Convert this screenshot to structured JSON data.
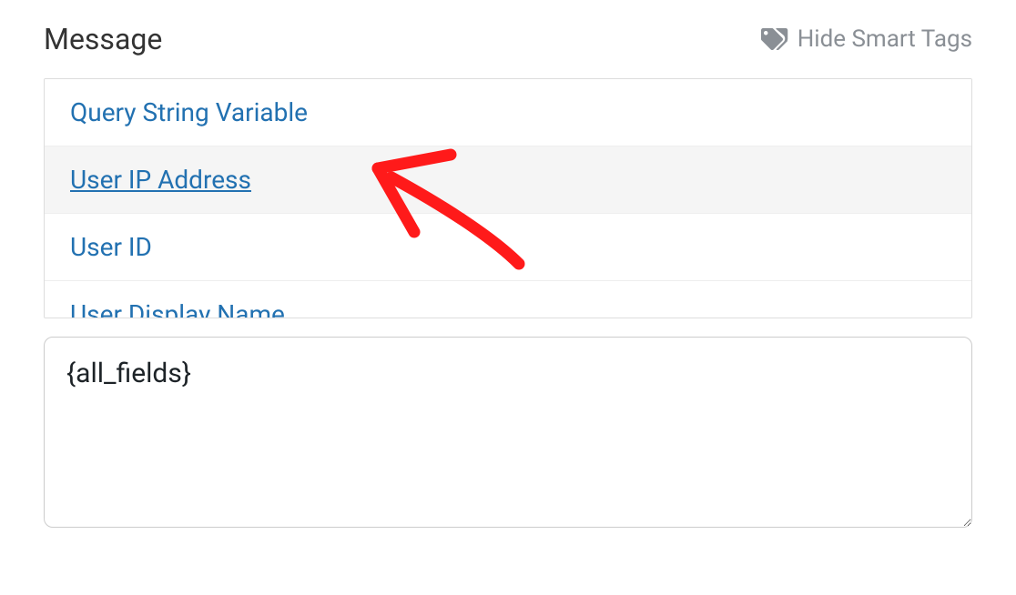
{
  "header": {
    "title": "Message",
    "toggle_label": "Hide Smart Tags"
  },
  "smart_tags": {
    "items": [
      {
        "label": "Query String Variable",
        "hovered": false
      },
      {
        "label": "User IP Address",
        "hovered": true
      },
      {
        "label": "User ID",
        "hovered": false
      },
      {
        "label": "User Display Name",
        "hovered": false
      }
    ]
  },
  "message": {
    "value": "{all_fields}"
  },
  "colors": {
    "link": "#2271b1",
    "muted": "#8a8f95",
    "annotation": "#ff1a1a"
  }
}
